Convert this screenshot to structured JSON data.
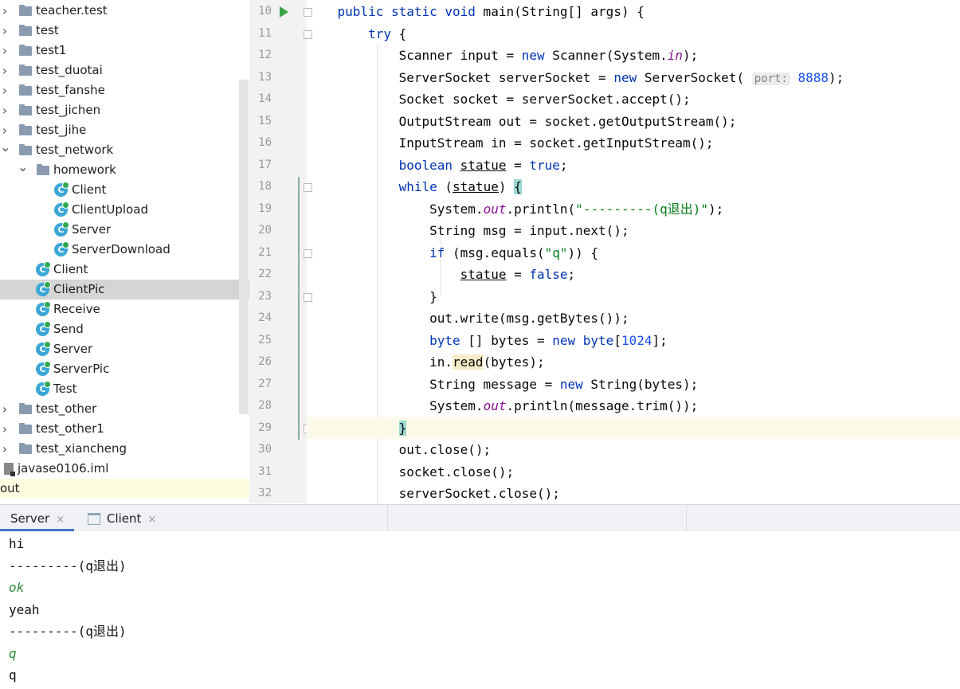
{
  "project_tree": {
    "items": [
      {
        "label": "teacher.test",
        "type": "folder",
        "expanded": false,
        "depth": 0
      },
      {
        "label": "test",
        "type": "folder",
        "expanded": false,
        "depth": 0
      },
      {
        "label": "test1",
        "type": "folder",
        "expanded": false,
        "depth": 0
      },
      {
        "label": "test_duotai",
        "type": "folder",
        "expanded": false,
        "depth": 0
      },
      {
        "label": "test_fanshe",
        "type": "folder",
        "expanded": false,
        "depth": 0
      },
      {
        "label": "test_jichen",
        "type": "folder",
        "expanded": false,
        "depth": 0
      },
      {
        "label": "test_jihe",
        "type": "folder",
        "expanded": false,
        "depth": 0
      },
      {
        "label": "test_network",
        "type": "folder",
        "expanded": true,
        "depth": 0
      },
      {
        "label": "homework",
        "type": "folder",
        "expanded": true,
        "depth": 1
      },
      {
        "label": "Client",
        "type": "class",
        "depth": 2
      },
      {
        "label": "ClientUpload",
        "type": "class",
        "depth": 2
      },
      {
        "label": "Server",
        "type": "class",
        "depth": 2
      },
      {
        "label": "ServerDownload",
        "type": "class",
        "depth": 2
      },
      {
        "label": "Client",
        "type": "class",
        "depth": 1
      },
      {
        "label": "ClientPic",
        "type": "class",
        "depth": 1,
        "selected": true
      },
      {
        "label": "Receive",
        "type": "class",
        "depth": 1
      },
      {
        "label": "Send",
        "type": "class",
        "depth": 1
      },
      {
        "label": "Server",
        "type": "class",
        "depth": 1
      },
      {
        "label": "ServerPic",
        "type": "class",
        "depth": 1
      },
      {
        "label": "Test",
        "type": "class",
        "depth": 1
      },
      {
        "label": "test_other",
        "type": "folder",
        "expanded": false,
        "depth": 0
      },
      {
        "label": "test_other1",
        "type": "folder",
        "expanded": false,
        "depth": 0
      },
      {
        "label": "test_xiancheng",
        "type": "folder",
        "expanded": false,
        "depth": 0
      },
      {
        "label": "javase0106.iml",
        "type": "iml",
        "depth": 0
      },
      {
        "label": "out",
        "type": "plain",
        "depth": 0,
        "highlighted": true
      }
    ]
  },
  "editor": {
    "lines": [
      {
        "num": "10",
        "html": "    <span class=\"kw\">public static void</span> main(String[] args) {"
      },
      {
        "num": "11",
        "html": "        <span class=\"kw\">try</span> {"
      },
      {
        "num": "12",
        "html": "            Scanner input = <span class=\"kw\">new</span> Scanner(System.<span class=\"fld\">in</span>);"
      },
      {
        "num": "13",
        "html": "            ServerSocket serverSocket = <span class=\"kw\">new</span> ServerSocket( <span class=\"hint\">port:</span> <span class=\"num\">8888</span>);"
      },
      {
        "num": "14",
        "html": "            Socket socket = serverSocket.accept();"
      },
      {
        "num": "15",
        "html": "            OutputStream out = socket.getOutputStream();"
      },
      {
        "num": "16",
        "html": "            InputStream in = socket.getInputStream();"
      },
      {
        "num": "17",
        "html": "            <span class=\"kw\">boolean</span> <span class=\"ul\">statue</span> = <span class=\"kw\">true</span>;"
      },
      {
        "num": "18",
        "html": "            <span class=\"kw\">while</span> (<span class=\"ul\">statue</span>) <span class=\"bm\">{</span>"
      },
      {
        "num": "19",
        "html": "                System.<span class=\"fld\">out</span>.println(<span class=\"str\">\"---------(q退出)\"</span>);"
      },
      {
        "num": "20",
        "html": "                String msg = input.next();"
      },
      {
        "num": "21",
        "html": "                <span class=\"kw\">if</span> (msg.equals(<span class=\"str\">\"q\"</span>)) {"
      },
      {
        "num": "22",
        "html": "                    <span class=\"ul\">statue</span> = <span class=\"kw\">false</span>;"
      },
      {
        "num": "23",
        "html": "                }"
      },
      {
        "num": "24",
        "html": "                out.write(msg.getBytes());"
      },
      {
        "num": "25",
        "html": "                <span class=\"kw\">byte</span> [] bytes = <span class=\"kw\">new byte</span>[<span class=\"num\">1024</span>];"
      },
      {
        "num": "26",
        "html": "                in.<span class=\"rd\">read</span>(bytes);"
      },
      {
        "num": "27",
        "html": "                String message = <span class=\"kw\">new</span> String(bytes);"
      },
      {
        "num": "28",
        "html": "                System.<span class=\"fld\">out</span>.println(message.trim());"
      },
      {
        "num": "29",
        "html": "            <span class=\"bm\">}</span>",
        "current": true
      },
      {
        "num": "30",
        "html": "            out.close();"
      },
      {
        "num": "31",
        "html": "            socket.close();"
      },
      {
        "num": "32",
        "html": "            serverSocket.close();"
      }
    ]
  },
  "run_tabs": [
    {
      "label": "Server",
      "close": "×",
      "active": true
    },
    {
      "label": "Client",
      "close": "×",
      "active": false
    }
  ],
  "console": {
    "lines": [
      {
        "text": "hi",
        "input": false
      },
      {
        "text": "---------(q退出)",
        "input": false
      },
      {
        "text": "ok",
        "input": true
      },
      {
        "text": "yeah",
        "input": false
      },
      {
        "text": "---------(q退出)",
        "input": false
      },
      {
        "text": "q",
        "input": true
      },
      {
        "text": "q",
        "input": false
      }
    ]
  },
  "colors": {
    "keyword": "#0033b3",
    "string": "#067d17",
    "number": "#1750eb",
    "static_field": "#871094",
    "selection": "#d5d5d5",
    "current_line": "#fcfae8",
    "tab_underline": "#3f73c6"
  }
}
